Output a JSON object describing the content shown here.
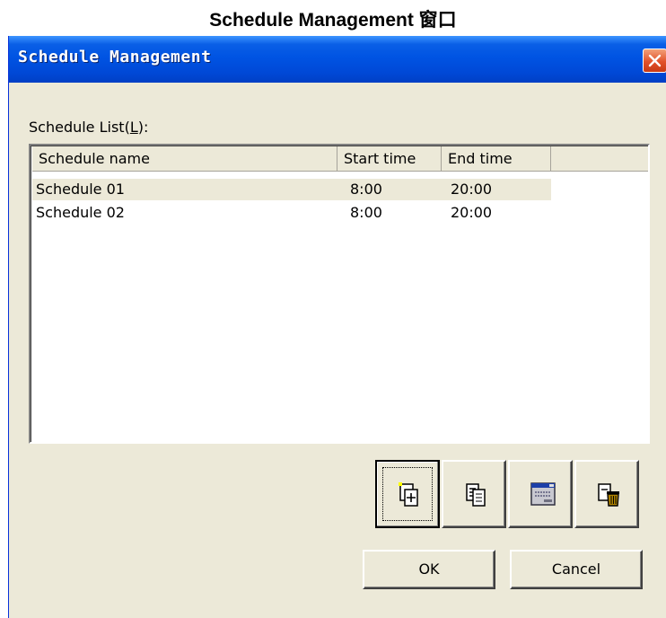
{
  "caption": {
    "text": "Schedule Management 窗口"
  },
  "window": {
    "title": "Schedule Management"
  },
  "list": {
    "label_prefix": "Schedule List(",
    "label_accel": "L",
    "label_suffix": "):",
    "columns": [
      "Schedule name",
      "Start time",
      "End time"
    ],
    "rows": [
      {
        "name": "Schedule 01",
        "start": "8:00",
        "end": "20:00",
        "selected": true
      },
      {
        "name": "Schedule 02",
        "start": "8:00",
        "end": "20:00",
        "selected": false
      }
    ]
  },
  "toolbar": {
    "icons": [
      "new-schedule-icon",
      "copy-schedule-icon",
      "edit-schedule-icon",
      "delete-schedule-icon"
    ]
  },
  "buttons": {
    "ok_label": "OK",
    "cancel_label": "Cancel"
  },
  "colors": {
    "titlebar": "#0054e3",
    "dialog_bg": "#ece9d8",
    "close_button": "#e2512a",
    "delete_bin": "#b08400"
  }
}
